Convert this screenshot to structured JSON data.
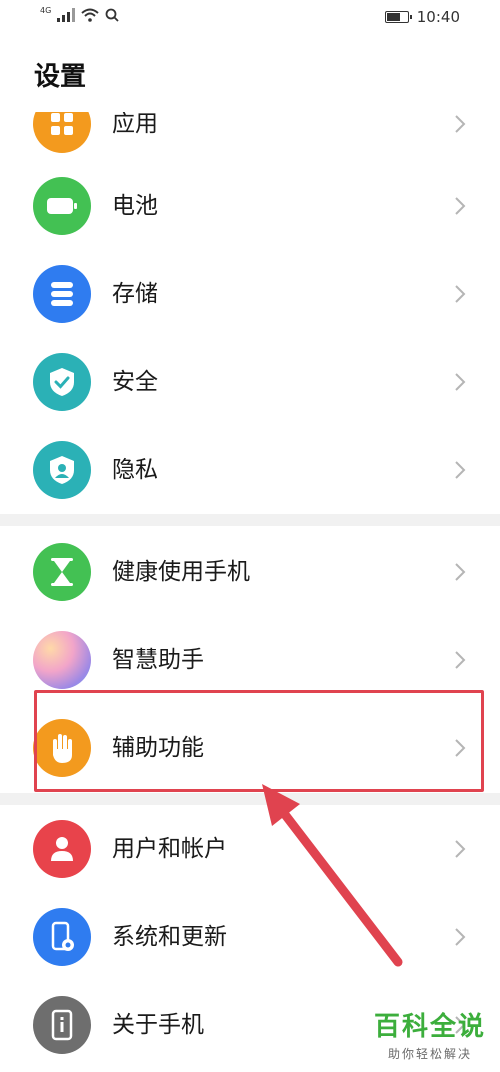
{
  "status_bar": {
    "network_label": "4G",
    "time": "10:40",
    "battery_level": 0.65
  },
  "page": {
    "title": "设置"
  },
  "settings_items": [
    {
      "label": "应用",
      "icon": "apps-icon",
      "color": "#f39a1e"
    },
    {
      "label": "电池",
      "icon": "battery-icon",
      "color": "#43c153"
    },
    {
      "label": "存储",
      "icon": "storage-icon",
      "color": "#2f7cf0"
    },
    {
      "label": "安全",
      "icon": "shield-icon",
      "color": "#2bb1b6"
    },
    {
      "label": "隐私",
      "icon": "privacy-icon",
      "color": "#2bb1b6"
    },
    {
      "label": "健康使用手机",
      "icon": "hourglass-icon",
      "color": "#43c153"
    },
    {
      "label": "智慧助手",
      "icon": "assistant-icon",
      "color": "#9b88e6"
    },
    {
      "label": "辅助功能",
      "icon": "hand-icon",
      "color": "#f39a1e"
    },
    {
      "label": "用户和帐户",
      "icon": "user-icon",
      "color": "#e8434b"
    },
    {
      "label": "系统和更新",
      "icon": "phone-update-icon",
      "color": "#2f7cf0"
    },
    {
      "label": "关于手机",
      "icon": "phone-info-icon",
      "color": "#6e6e6e"
    }
  ],
  "watermark": {
    "main": "百科全说",
    "sub": "助你轻松解决"
  },
  "colors": {
    "highlight": "#e0434f",
    "arrow": "#e0434f",
    "watermark": "#3cae3c"
  }
}
